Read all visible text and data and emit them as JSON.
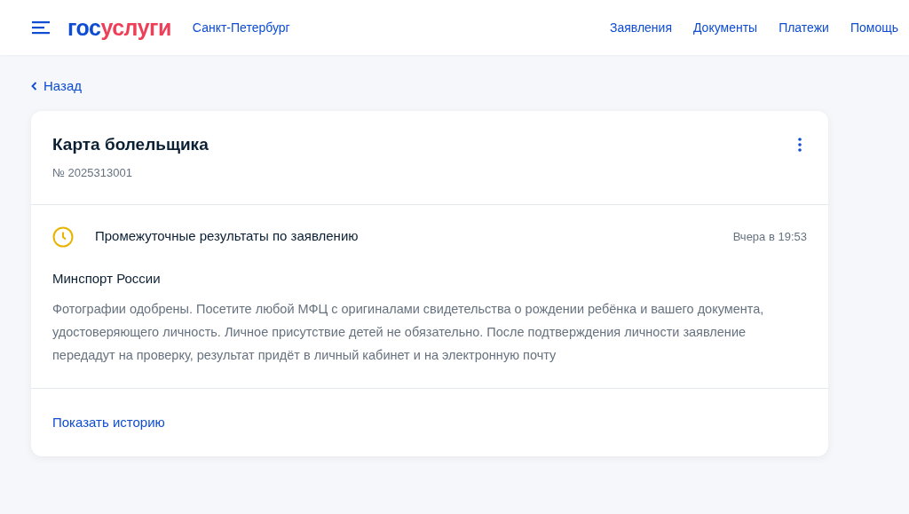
{
  "header": {
    "logo": {
      "part_1": "гос",
      "part_2": "услуги"
    },
    "region": "Санкт-Петербург",
    "nav": [
      "Заявления",
      "Документы",
      "Платежи",
      "Помощь"
    ]
  },
  "back_link": "Назад",
  "card": {
    "title": "Карта болельщика",
    "number": "№ 2025313001",
    "status": {
      "text": "Промежуточные результаты по заявлению",
      "time": "Вчера в 19:53"
    },
    "sender": "Минспорт России",
    "message": "Фотографии одобрены. Посетите любой МФЦ с оригиналами свидетельства о рождении ребёнка и вашего документа, удостоверяющего личность. Личное присутствие детей не обязательно. После подтверждения личности заявление передадут на проверку, результат придёт в личный кабинет и на электронную почту",
    "history_link": "Показать историю"
  }
}
